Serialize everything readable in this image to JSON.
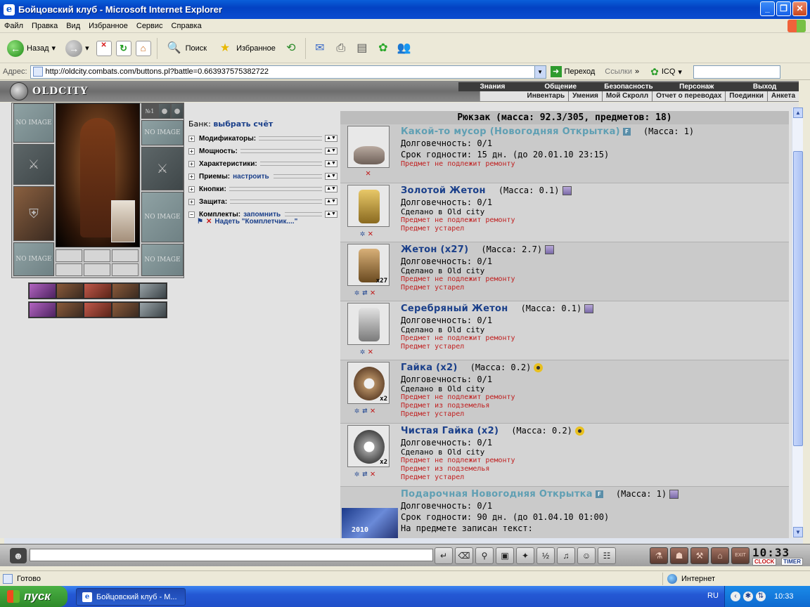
{
  "window": {
    "title": "Бойцовский клуб - Microsoft Internet Explorer",
    "btn_minimize": "_",
    "btn_maximize": "❐",
    "btn_close": "✕"
  },
  "menu": [
    "Файл",
    "Правка",
    "Вид",
    "Избранное",
    "Сервис",
    "Справка"
  ],
  "toolbar": {
    "back": "Назад",
    "search": "Поиск",
    "favorites": "Избранное"
  },
  "address": {
    "label": "Адрес:",
    "url": "http://oldcity.combats.com/buttons.pl?battle=0.663937575382722",
    "go": "Переход",
    "links": "Ссылки",
    "icq": "ICQ"
  },
  "game": {
    "logo": "OLDCITY",
    "nav_top": [
      "Знания",
      "Общение",
      "Безопасность",
      "Персонаж",
      "Выход"
    ],
    "nav_bottom": [
      "Инвентарь",
      "Умения",
      "Мой Скролл",
      "Отчет о переводах",
      "Поединки",
      "Анкета"
    ],
    "bank_label": "Банк:",
    "bank_link": "выбрать счёт",
    "sections": [
      {
        "label": "Модификаторы:",
        "link": ""
      },
      {
        "label": "Мощность:",
        "link": ""
      },
      {
        "label": "Характеристики:",
        "link": ""
      },
      {
        "label": "Приемы:",
        "link": "настроить"
      },
      {
        "label": "Кнопки:",
        "link": ""
      },
      {
        "label": "Защита:",
        "link": ""
      },
      {
        "label": "Комплекты:",
        "link": "запомнить"
      }
    ],
    "kit_item": "Надеть \"Комплетчик....\"",
    "no_image": "NO IMAGE",
    "slot_number": "№1",
    "inventory_header": "Рюкзак (масса: 92.3/305, предметов: 18)",
    "items": [
      {
        "name": "Какой-то мусор (Новогодняя Открытка)",
        "mass": "(Масса: 1)",
        "dur": "Долговечность: 0/1",
        "expiry": "Срок годности: 15 дн. (до 20.01.10 23:15)",
        "made": "",
        "notes": [
          "Предмет не подлежит ремонту"
        ],
        "qty": ""
      },
      {
        "name": "Золотой Жетон",
        "mass": "(Масса: 0.1)",
        "dur": "Долговечность: 0/1",
        "expiry": "",
        "made": "Сделано в Old city",
        "notes": [
          "Предмет не подлежит ремонту",
          "Предмет устарел"
        ],
        "qty": ""
      },
      {
        "name": "Жетон (x27)",
        "mass": "(Масса: 2.7)",
        "dur": "Долговечность: 0/1",
        "expiry": "",
        "made": "Сделано в Old city",
        "notes": [
          "Предмет не подлежит ремонту",
          "Предмет устарел"
        ],
        "qty": "x27"
      },
      {
        "name": "Серебряный Жетон",
        "mass": "(Масса: 0.1)",
        "dur": "Долговечность: 0/1",
        "expiry": "",
        "made": "Сделано в Old city",
        "notes": [
          "Предмет не подлежит ремонту",
          "Предмет устарел"
        ],
        "qty": ""
      },
      {
        "name": "Гайка (x2)",
        "mass": "(Масса: 0.2)",
        "dur": "Долговечность: 0/1",
        "expiry": "",
        "made": "Сделано в Old city",
        "notes": [
          "Предмет не подлежит ремонту",
          "Предмет из подземелья",
          "Предмет устарел"
        ],
        "qty": "x2"
      },
      {
        "name": "Чистая Гайка (x2)",
        "mass": "(Масса: 0.2)",
        "dur": "Долговечность: 0/1",
        "expiry": "",
        "made": "Сделано в Old city",
        "notes": [
          "Предмет не подлежит ремонту",
          "Предмет из подземелья",
          "Предмет устарел"
        ],
        "qty": "x2"
      },
      {
        "name": "Подарочная Новогодняя Открытка",
        "mass": "(Масса: 1)",
        "dur": "Долговечность: 0/1",
        "expiry": "Срок годности: 90 дн. (до 01.04.10 01:00)",
        "made": "",
        "notes": [],
        "extra": "На предмете записан текст:",
        "qty": ""
      }
    ],
    "card_text": "2010"
  },
  "chat": {
    "clock": "10:33",
    "clock_label": "CLOCK",
    "timer_label": "TIMER",
    "exit_label": "EXIT"
  },
  "status": {
    "text": "Готово",
    "zone": "Интернет"
  },
  "taskbar": {
    "start": "пуск",
    "task": "Бойцовский клуб - М...",
    "lang": "RU",
    "time": "10:33"
  }
}
